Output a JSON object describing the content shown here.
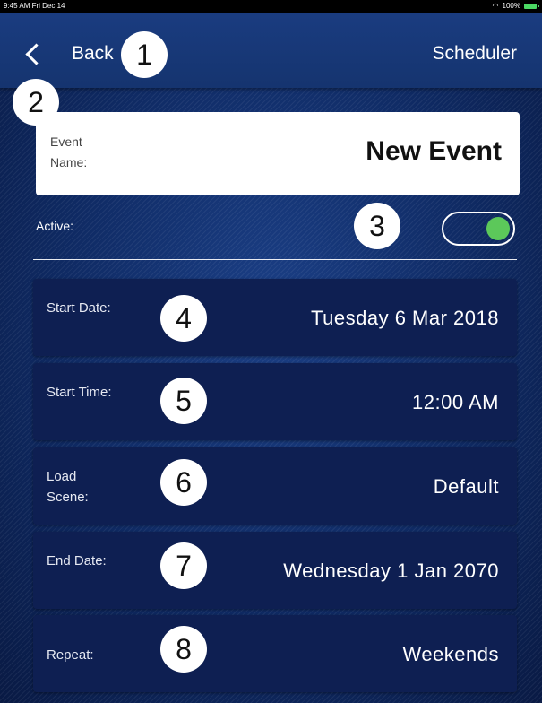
{
  "status_bar": {
    "time": "9:45 AM",
    "date": "Fri Dec 14",
    "battery": "100%"
  },
  "nav": {
    "back_label": "Back",
    "title": "Scheduler"
  },
  "callouts": [
    "1",
    "2",
    "3",
    "4",
    "5",
    "6",
    "7",
    "8"
  ],
  "event_name": {
    "label": "Event Name:",
    "value": "New Event"
  },
  "active": {
    "label": "Active:",
    "on": true
  },
  "rows": [
    {
      "label": "Start Date:",
      "value": "Tuesday 6 Mar 2018"
    },
    {
      "label": "Start Time:",
      "value": "12:00 AM"
    },
    {
      "label": "Load Scene:",
      "value": "Default"
    },
    {
      "label": "End Date:",
      "value": "Wednesday 1 Jan 2070"
    },
    {
      "label": "Repeat:",
      "value": "Weekends"
    }
  ],
  "colors": {
    "toggle_on": "#5cc85a",
    "row_background": "#0e1f52",
    "nav_background": "#1a3c80"
  }
}
